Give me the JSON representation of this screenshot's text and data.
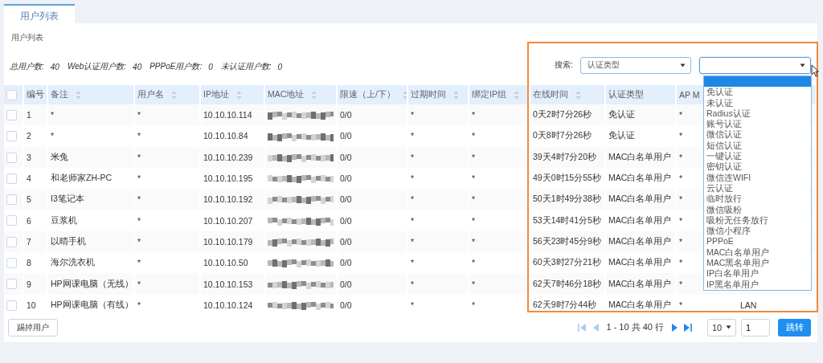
{
  "tabs": [
    {
      "label": "用户列表",
      "selected": true
    }
  ],
  "panel_title": "用户列表",
  "stats": [
    {
      "label": "总用户数:",
      "value": "40"
    },
    {
      "label": "Web认证用户数:",
      "value": "40"
    },
    {
      "label": "PPPoE用户数:",
      "value": "0"
    },
    {
      "label": "未认证用户数:",
      "value": "0"
    }
  ],
  "search": {
    "label": "搜索:",
    "field_select": {
      "value": "认证类型"
    },
    "value_select": {
      "expanded": true,
      "options": [
        {
          "selected": true
        },
        {
          "label": "免认证",
          "selected": false
        },
        {
          "label": "未认证",
          "selected": false
        },
        {
          "label": "Radius认证",
          "selected": false
        },
        {
          "label": "账号认证",
          "selected": false
        },
        {
          "label": "微信认证",
          "selected": false
        },
        {
          "label": "短信认证",
          "selected": false
        },
        {
          "label": "一键认证",
          "selected": false
        },
        {
          "label": "密钥认证",
          "selected": false
        },
        {
          "label": "微信连WIFI",
          "selected": false
        },
        {
          "label": "云认证",
          "selected": false
        },
        {
          "label": "临时放行",
          "selected": false
        },
        {
          "label": "微信吸粉",
          "selected": false
        },
        {
          "label": "吸粉无任务放行",
          "selected": false
        },
        {
          "label": "微信小程序",
          "selected": false
        },
        {
          "label": "PPPoE",
          "selected": false
        },
        {
          "label": "MAC白名单用户",
          "selected": false
        },
        {
          "label": "MAC黑名单用户",
          "selected": false
        },
        {
          "label": "IP白名单用户",
          "selected": false
        },
        {
          "label": "IP黑名单用户",
          "selected": false
        }
      ]
    }
  },
  "table": {
    "header_checked": false,
    "columns": [
      {
        "label": "编号",
        "sortable": false
      },
      {
        "label": "备注",
        "sortable": true
      },
      {
        "label": "用户名",
        "sortable": true
      },
      {
        "label": "IP地址",
        "sortable": true
      },
      {
        "label": "MAC地址",
        "sortable": true
      },
      {
        "label": "限速（上/下）",
        "sortable": true
      },
      {
        "label": "过期时间",
        "sortable": true
      },
      {
        "label": "绑定IP组",
        "sortable": true
      },
      {
        "label": "在线时间",
        "sortable": true
      },
      {
        "label": "认证类型",
        "sortable": false
      },
      {
        "label": "AP M",
        "sortable": false
      }
    ],
    "rows": [
      {
        "checked": false,
        "cells": [
          "1",
          "*",
          "*",
          "10.10.10.114",
          "",
          "0/0",
          "*",
          "*",
          "0天2时7分26秒",
          "免认证",
          "*"
        ]
      },
      {
        "checked": false,
        "cells": [
          "2",
          "*",
          "*",
          "10.10.10.84",
          "",
          "0/0",
          "*",
          "*",
          "0天8时7分26秒",
          "免认证",
          "*"
        ]
      },
      {
        "checked": false,
        "cells": [
          "3",
          "米兔",
          "*",
          "10.10.10.239",
          "",
          "0/0",
          "*",
          "*",
          "39天4时7分20秒",
          "MAC白名单用户",
          "*"
        ]
      },
      {
        "checked": false,
        "cells": [
          "4",
          "和老师家ZH-PC",
          "*",
          "10.10.10.195",
          "",
          "0/0",
          "*",
          "*",
          "49天0时15分55秒",
          "MAC白名单用户",
          "*"
        ]
      },
      {
        "checked": false,
        "cells": [
          "5",
          "I3笔记本",
          "*",
          "10.10.10.192",
          "",
          "0/0",
          "*",
          "*",
          "50天1时49分38秒",
          "MAC白名单用户",
          "*"
        ]
      },
      {
        "checked": false,
        "cells": [
          "6",
          "豆浆机",
          "*",
          "10.10.10.207",
          "",
          "0/0",
          "*",
          "*",
          "53天14时41分5秒",
          "MAC白名单用户",
          "*"
        ]
      },
      {
        "checked": false,
        "cells": [
          "7",
          "以晴手机",
          "*",
          "10.10.10.179",
          "",
          "0/0",
          "*",
          "*",
          "56天23时45分9秒",
          "MAC白名单用户",
          "*"
        ]
      },
      {
        "checked": false,
        "cells": [
          "8",
          "海尔洗衣机",
          "*",
          "10.10.10.50",
          "",
          "0/0",
          "*",
          "*",
          "60天3时27分21秒",
          "MAC白名单用户",
          "*"
        ]
      },
      {
        "checked": false,
        "cells": [
          "9",
          "HP网课电脑（无线）",
          "*",
          "10.10.10.153",
          "",
          "0/0",
          "*",
          "*",
          "62天7时46分18秒",
          "MAC白名单用户",
          "*"
        ]
      },
      {
        "checked": false,
        "cells": [
          "10",
          "HP网课电脑（有线）",
          "*",
          "10.10.10.124",
          "",
          "0/0",
          "*",
          "*",
          "62天9时7分44秒",
          "MAC白名单用户",
          "*",
          "LAN"
        ]
      }
    ]
  },
  "kick_button": "踢掉用户",
  "pager": {
    "buttons": [
      {
        "kind": "first",
        "disabled": true
      },
      {
        "kind": "prev",
        "disabled": true
      },
      {
        "kind": "next",
        "disabled": false
      },
      {
        "kind": "last",
        "disabled": false
      }
    ],
    "range": "1 - 10 共 40 行",
    "page_size": "10",
    "page_input": "1",
    "go_button": "跳转"
  }
}
